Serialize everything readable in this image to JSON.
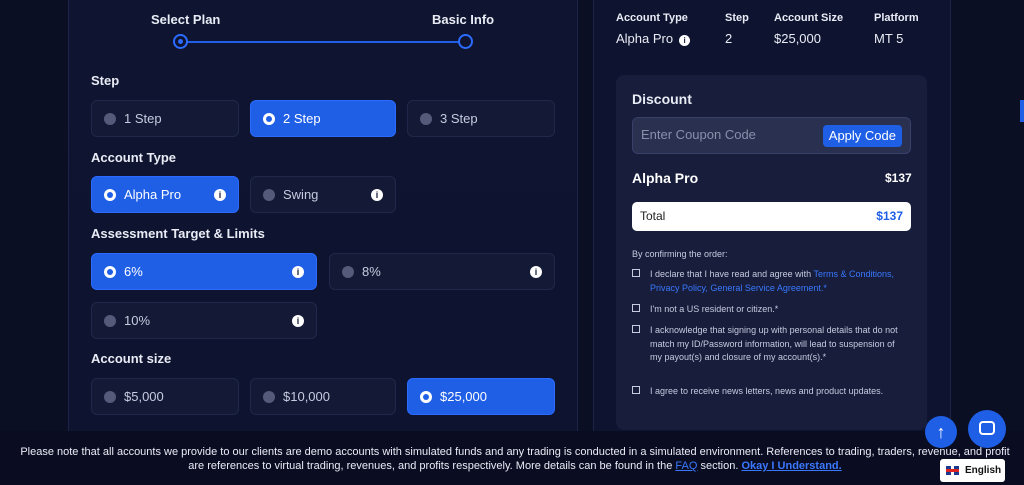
{
  "progress": {
    "steps": [
      "Select Plan",
      "Basic Info"
    ]
  },
  "sections": {
    "step": "Step",
    "account_type": "Account Type",
    "assessment": "Assessment Target & Limits",
    "account_size": "Account size"
  },
  "step_options": [
    "1 Step",
    "2 Step",
    "3 Step"
  ],
  "account_type_options": [
    "Alpha Pro",
    "Swing"
  ],
  "assessment_options": [
    "6%",
    "8%",
    "10%"
  ],
  "size_options": [
    "$5,000",
    "$10,000",
    "$25,000"
  ],
  "selected": {
    "step": "2 Step",
    "account_type": "Alpha Pro",
    "assessment": "6%",
    "size": "$25,000"
  },
  "summary": {
    "headers": [
      "Account Type",
      "Step",
      "Account Size",
      "Platform"
    ],
    "values": [
      "Alpha Pro",
      "2",
      "$25,000",
      "MT 5"
    ]
  },
  "discount": {
    "title": "Discount",
    "placeholder": "Enter Coupon Code",
    "apply_label": "Apply Code",
    "plan_name": "Alpha Pro",
    "plan_price": "$137",
    "total_label": "Total",
    "total_value": "$137"
  },
  "confirm": {
    "intro": "By confirming the order:",
    "c1_text": "I declare that I have read and agree with ",
    "c1_link": "Terms & Conditions, Privacy Policy, General Service Agreement.*",
    "c2": "I'm not a US resident or citizen.*",
    "c3": "I acknowledge that signing up with personal details that do not match my ID/Password information, will lead to suspension of my payout(s) and closure of my account(s).*",
    "c4": "I agree to receive news letters, news and product updates."
  },
  "notice": {
    "text": "Please note that all accounts we provide to our clients are demo accounts with simulated funds and any trading is conducted in a simulated environment. References to trading, traders, revenue, and profit are references to virtual trading, revenues, and profits respectively. More details can be found in the ",
    "faq": "FAQ",
    "section": " section. ",
    "ok": "Okay I Understand."
  },
  "language": "English",
  "colors": {
    "accent": "#1f5fe6",
    "background": "#0b0f24",
    "panel": "#0e1330"
  }
}
